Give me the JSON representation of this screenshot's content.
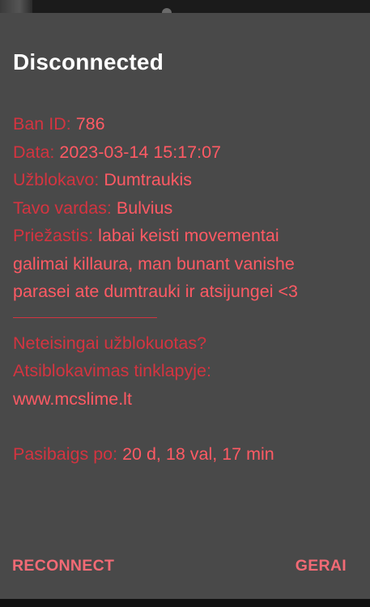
{
  "dialog": {
    "title": "Disconnected",
    "ban": {
      "id_label": "Ban ID:",
      "id_value": "786",
      "date_label": "Data:",
      "date_value": "2023-03-14 15:17:07",
      "banned_by_label": "Užblokavo:",
      "banned_by_value": "Dumtraukis",
      "your_name_label": "Tavo vardas:",
      "your_name_value": "Bulvius",
      "reason_label": "Priežastis:",
      "reason_value": "labai keisti movementai galimai killaura, man bunant vanishe parasei ate dumtrauki ir atsijungei <3",
      "unfair_question": "Neteisingai užblokuotas?",
      "appeal_text": "Atsiblokavimas tinklapyje:",
      "website": "www.mcslime.lt",
      "expires_label": "Pasibaigs po:",
      "expires_value": "20 d, 18 val, 17 min"
    },
    "buttons": {
      "reconnect": "RECONNECT",
      "ok": "GERAI"
    }
  },
  "colors": {
    "dialog_bg": "#494949",
    "label_red": "#d43440",
    "value_red": "#ff5a64",
    "button_accent": "#f26a75",
    "title": "#ffffff"
  }
}
